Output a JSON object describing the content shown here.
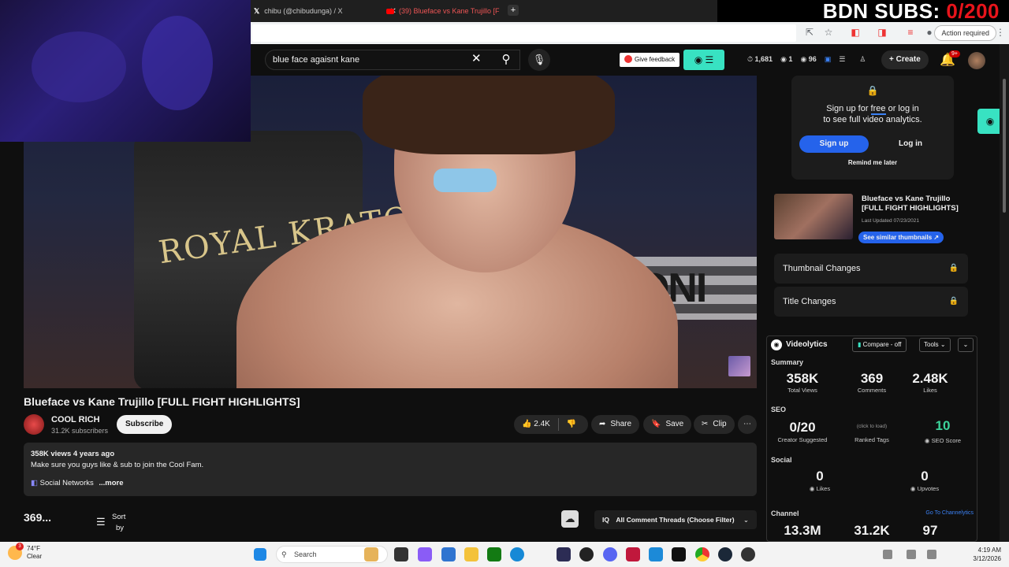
{
  "overlay": {
    "subs_label": "BDN SUBS: ",
    "subs_value": "0/200"
  },
  "browser": {
    "tabs": [
      {
        "title": "chibu (@chibudunga) / X"
      },
      {
        "title": "(39) Blueface vs Kane Trujillo [F"
      }
    ],
    "new_tab": "+",
    "action_required": "Action required"
  },
  "youtube": {
    "search_value": "blue face agaisnt kane",
    "feedback_label": "Give feedback",
    "stats": {
      "views": "1,681",
      "one": "1",
      "ninety_six": "96"
    },
    "create_label": "Create",
    "notif_badge": "9+"
  },
  "video": {
    "title": "Blueface vs Kane Trujillo [FULL FIGHT HIGHLIGHTS]",
    "channel": "COOL RICH",
    "subscribers": "31.2K subscribers",
    "subscribe_label": "Subscribe",
    "likes": "2.4K",
    "share_label": "Share",
    "save_label": "Save",
    "clip_label": "Clip",
    "more_label": "⋯",
    "pad_text": "ROYAL KRATO",
    "ring_text": "TONI"
  },
  "description": {
    "meta": "358K views  4 years ago",
    "line1": "Make sure you guys like & sub to join the Cool Fam.",
    "line2": "Social Networks",
    "more": "...more"
  },
  "comments": {
    "count": "369...",
    "sort_line1": "Sort",
    "sort_line2": "by",
    "threads_label": "All Comment Threads (Choose Filter)"
  },
  "sidebar": {
    "signup_text1": "Sign up for ",
    "signup_free": "free",
    "signup_text2": " or log in",
    "signup_text3": "to see full video analytics.",
    "signup_button": "Sign up",
    "login_button": "Log in",
    "remind": "Remind me later",
    "sim_title": "Blueface vs Kane Trujillo [FULL FIGHT HIGHLIGHTS]",
    "last_updated": "Last Updated 07/23/2021",
    "similar_btn": "See similar thumbnails ↗",
    "thumbnail_changes": "Thumbnail Changes",
    "title_changes": "Title Changes"
  },
  "videolytics": {
    "title": "Videolytics",
    "compare": "Compare - off",
    "tools": "Tools",
    "summary_label": "Summary",
    "total_views": "358K",
    "total_views_label": "Total Views",
    "comments": "369",
    "comments_label": "Comments",
    "likes": "2.48K",
    "likes_label": "Likes",
    "seo_label": "SEO",
    "creator_suggested": "0/20",
    "creator_suggested_label": "Creator Suggested",
    "click_to_load": "(click to load)",
    "ranked_tags_label": "Ranked Tags",
    "seo_score": "10",
    "seo_score_label": "SEO Score",
    "social_label": "Social",
    "social_likes": "0",
    "social_likes_label": "Likes",
    "upvotes": "0",
    "upvotes_label": "Upvotes",
    "channel_label": "Channel",
    "channelytics_link": "Go To Channelytics",
    "channel_stat1": "13.3M",
    "channel_stat2": "31.2K",
    "channel_stat3": "97"
  },
  "taskbar": {
    "temp": "74°F",
    "condition": "Clear",
    "weather_badge": "3",
    "search_label": "Search",
    "time": "4:19 AM",
    "date": "3/12/2026"
  },
  "colors": {
    "accent": "#38e2c2",
    "youtube_red": "#cc0000",
    "vidiq_blue": "#3b82f6"
  }
}
